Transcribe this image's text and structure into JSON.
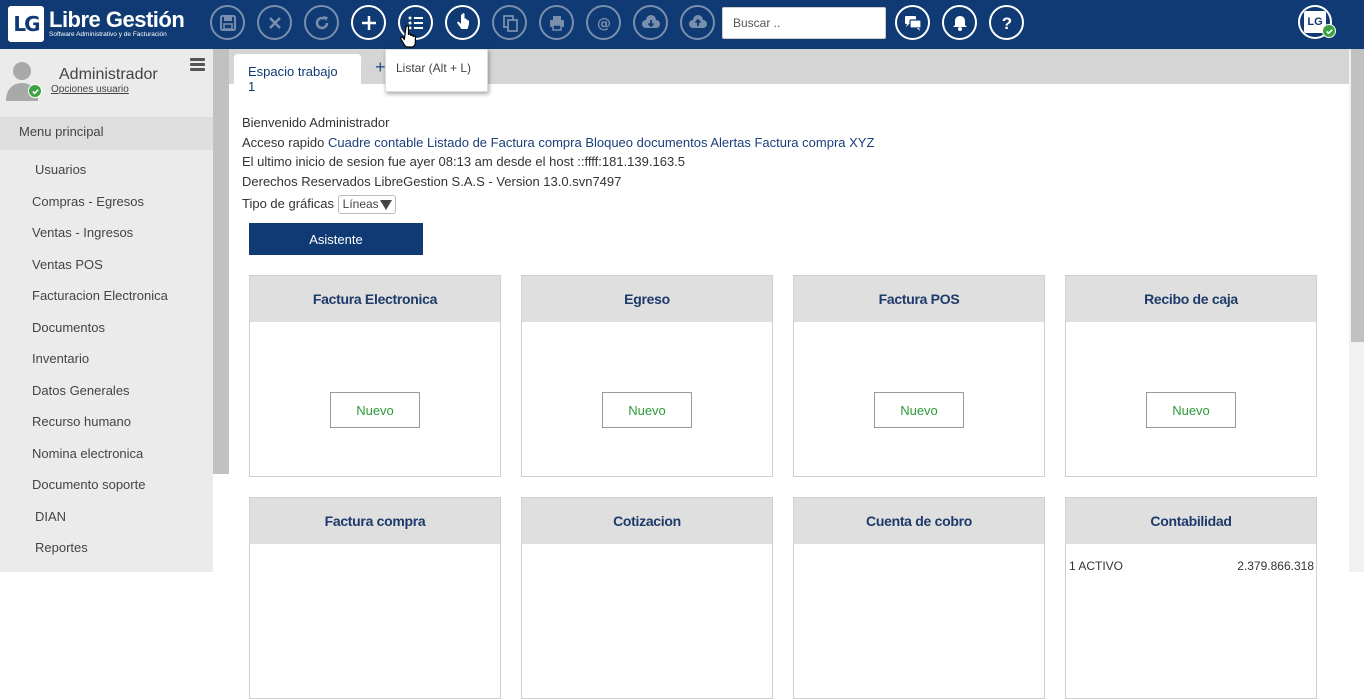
{
  "app": {
    "logo_mark": "LG",
    "logo_title": "Libre Gestión",
    "logo_subtitle": "Software Administrativo y de Facturación"
  },
  "toolbar": {
    "buttons": [
      {
        "name": "save-icon",
        "enabled": false
      },
      {
        "name": "cancel-icon",
        "enabled": false
      },
      {
        "name": "refresh-icon",
        "enabled": false
      },
      {
        "name": "add-icon",
        "enabled": true
      },
      {
        "name": "list-icon",
        "enabled": true
      },
      {
        "name": "hand-pointer-icon",
        "enabled": true
      },
      {
        "name": "copy-icon",
        "enabled": false
      },
      {
        "name": "print-icon",
        "enabled": false
      },
      {
        "name": "email-icon",
        "enabled": false
      },
      {
        "name": "cloud-download-icon",
        "enabled": false
      },
      {
        "name": "cloud-upload-icon",
        "enabled": false
      },
      {
        "name": "chat-icon",
        "enabled": true
      },
      {
        "name": "bell-icon",
        "enabled": true
      },
      {
        "name": "help-icon",
        "enabled": true
      }
    ],
    "search_placeholder": "Buscar ..",
    "tooltip": "Listar (Alt + L)"
  },
  "colors": {
    "brand": "#0f3a73",
    "success": "#3aa23e",
    "nuevo_text": "#2d9a36"
  },
  "sidebar": {
    "user_name": "Administrador",
    "user_options": "Opciones usuario",
    "menu_header": "Menu principal",
    "items": [
      {
        "label": "Usuarios",
        "indent": true
      },
      {
        "label": "Compras - Egresos",
        "indent": false
      },
      {
        "label": "Ventas - Ingresos",
        "indent": false
      },
      {
        "label": "Ventas POS",
        "indent": false
      },
      {
        "label": "Facturacion Electronica",
        "indent": false
      },
      {
        "label": "Documentos",
        "indent": false
      },
      {
        "label": "Inventario",
        "indent": false
      },
      {
        "label": "Datos Generales",
        "indent": false
      },
      {
        "label": "Recurso humano",
        "indent": false
      },
      {
        "label": "Nomina electronica",
        "indent": false
      },
      {
        "label": "Documento soporte",
        "indent": false
      },
      {
        "label": "DIAN",
        "indent": true
      },
      {
        "label": "Reportes",
        "indent": true
      }
    ]
  },
  "tabs": {
    "active": "Espacio trabajo 1",
    "add": "+"
  },
  "main": {
    "welcome": "Bienvenido Administrador",
    "quick_access_label": "Acceso rapido",
    "quick_links": [
      "Cuadre contable",
      "Listado de Factura compra",
      "Bloqueo documentos",
      "Alertas",
      "Factura compra XYZ"
    ],
    "last_login": "El ultimo inicio de sesion fue  ayer 08:13 am  desde el host ::ffff:181.139.163.5",
    "rights": "Derechos Reservados LibreGestion S.A.S -  Version 13.0.svn7497",
    "chart_type_label": "Tipo de gráficas",
    "chart_type_value": "Líneas",
    "assistant_button": "Asistente"
  },
  "cards": [
    {
      "title": "Factura Electronica",
      "button": "Nuevo"
    },
    {
      "title": "Egreso",
      "button": "Nuevo"
    },
    {
      "title": "Factura POS",
      "button": "Nuevo"
    },
    {
      "title": "Recibo de caja",
      "button": "Nuevo"
    },
    {
      "title": "Factura compra"
    },
    {
      "title": "Cotizacion"
    },
    {
      "title": "Cuenta de cobro"
    },
    {
      "title": "Contabilidad",
      "account": {
        "name": "1 ACTIVO",
        "value": "2.379.866.318"
      }
    }
  ]
}
